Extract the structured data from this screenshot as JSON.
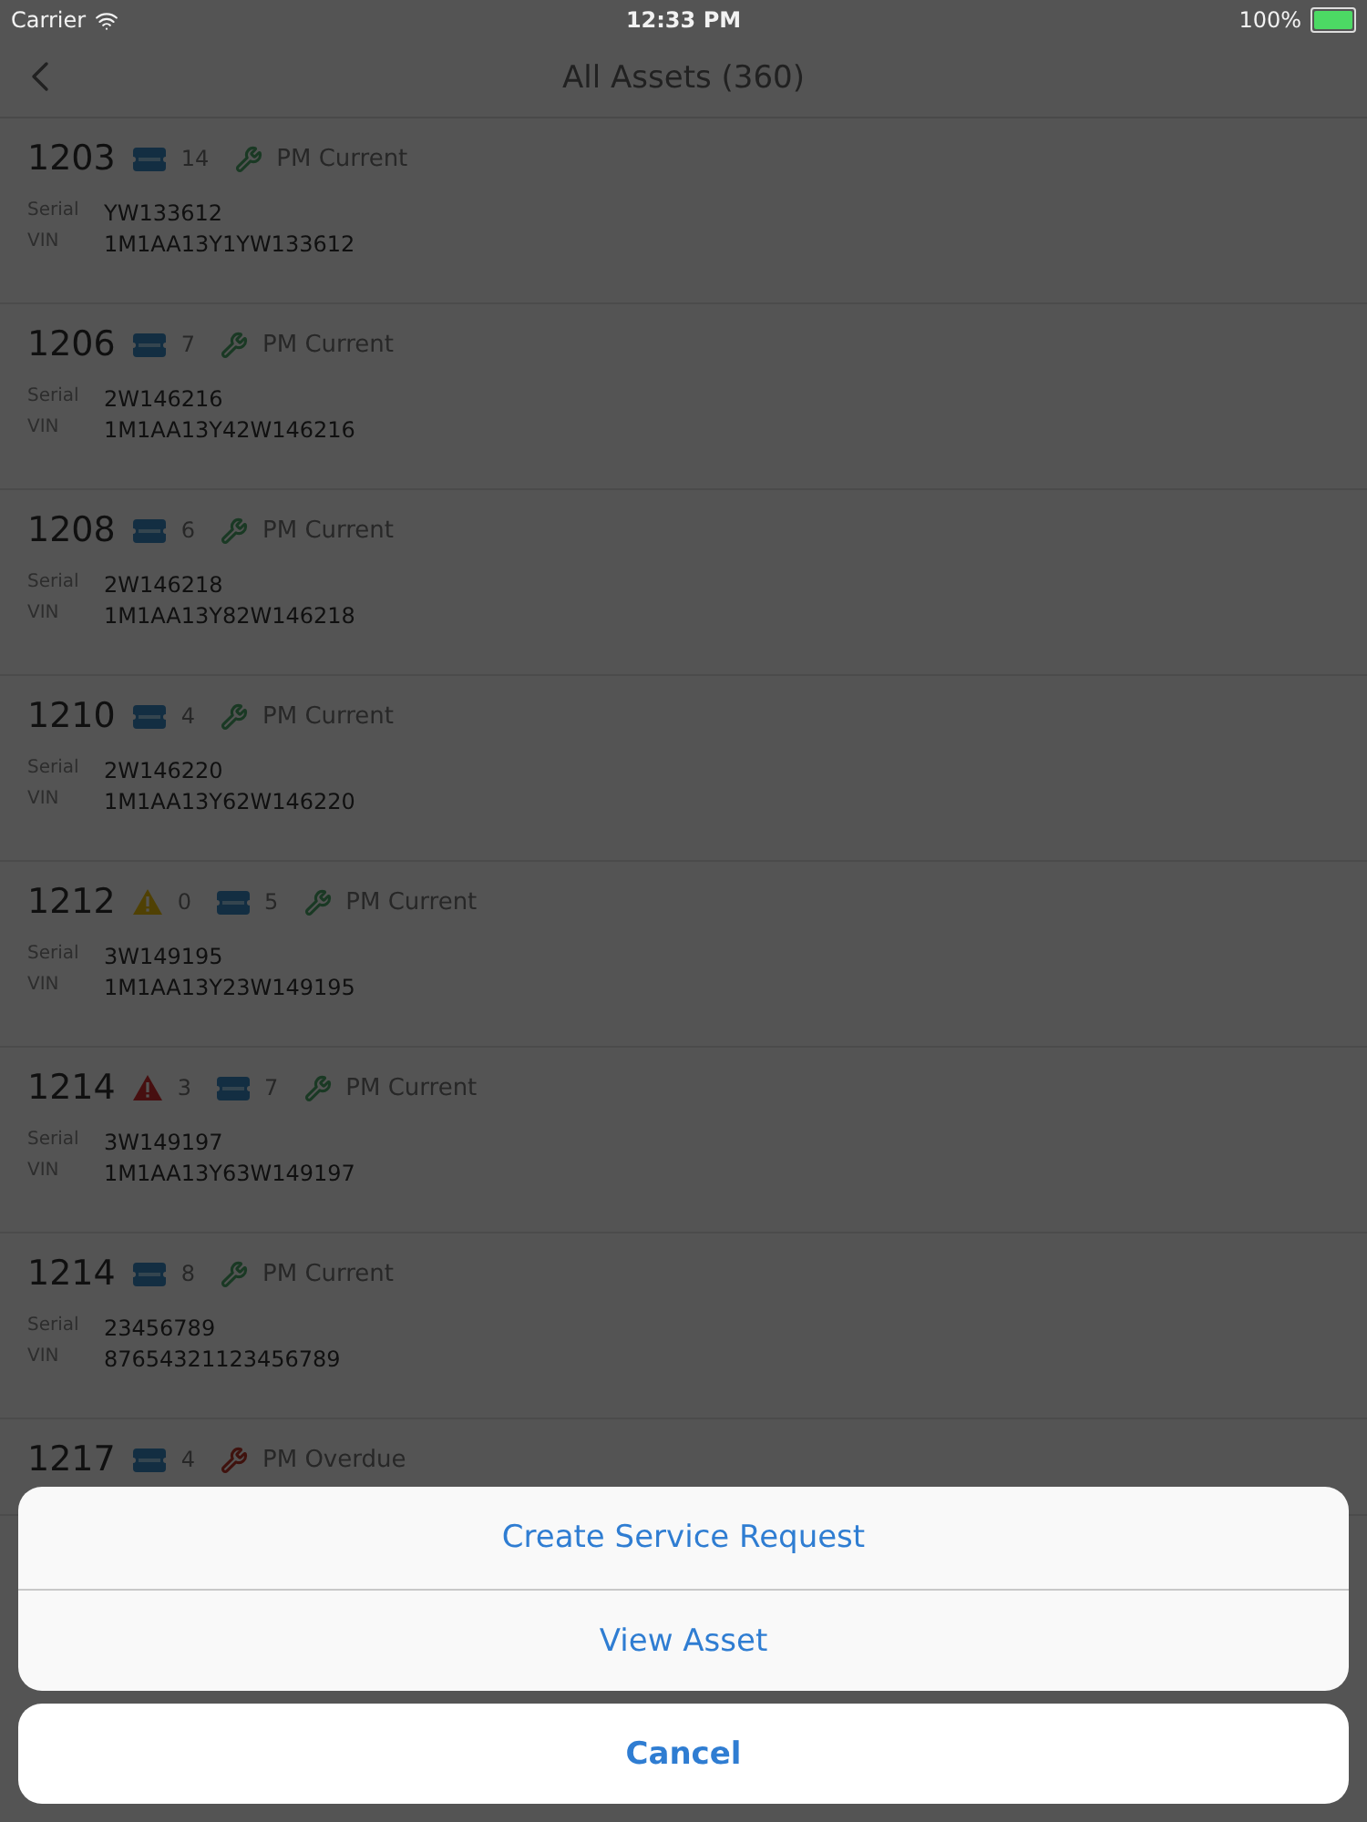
{
  "status_bar": {
    "carrier": "Carrier",
    "time": "12:33 PM",
    "battery": "100%"
  },
  "nav": {
    "title": "All Assets (360)"
  },
  "assets": [
    {
      "number": "1203",
      "tickets": "14",
      "pm": {
        "label": "PM Current",
        "kind": "current"
      },
      "serial_label": "Serial",
      "serial": "YW133612",
      "vin_label": "VIN",
      "vin": "1M1AA13Y1YW133612"
    },
    {
      "number": "1206",
      "tickets": "7",
      "pm": {
        "label": "PM Current",
        "kind": "current"
      },
      "serial_label": "Serial",
      "serial": "2W146216",
      "vin_label": "VIN",
      "vin": "1M1AA13Y42W146216"
    },
    {
      "number": "1208",
      "tickets": "6",
      "pm": {
        "label": "PM Current",
        "kind": "current"
      },
      "serial_label": "Serial",
      "serial": "2W146218",
      "vin_label": "VIN",
      "vin": "1M1AA13Y82W146218"
    },
    {
      "number": "1210",
      "tickets": "4",
      "pm": {
        "label": "PM Current",
        "kind": "current"
      },
      "serial_label": "Serial",
      "serial": "2W146220",
      "vin_label": "VIN",
      "vin": "1M1AA13Y62W146220"
    },
    {
      "number": "1212",
      "alerts": [
        {
          "kind": "warning",
          "count": "0"
        }
      ],
      "tickets": "5",
      "pm": {
        "label": "PM Current",
        "kind": "current"
      },
      "serial_label": "Serial",
      "serial": "3W149195",
      "vin_label": "VIN",
      "vin": "1M1AA13Y23W149195"
    },
    {
      "number": "1214",
      "alerts": [
        {
          "kind": "critical",
          "count": "3"
        }
      ],
      "tickets": "7",
      "pm": {
        "label": "PM Current",
        "kind": "current"
      },
      "serial_label": "Serial",
      "serial": "3W149197",
      "vin_label": "VIN",
      "vin": "1M1AA13Y63W149197"
    },
    {
      "number": "1214",
      "tickets": "8",
      "pm": {
        "label": "PM Current",
        "kind": "current"
      },
      "serial_label": "Serial",
      "serial": "23456789",
      "vin_label": "VIN",
      "vin": "87654321123456789"
    },
    {
      "number": "1217",
      "tickets": "4",
      "pm": {
        "label": "PM Overdue",
        "kind": "overdue"
      }
    }
  ],
  "action_sheet": {
    "actions": [
      "Create Service Request",
      "View Asset"
    ],
    "cancel": "Cancel"
  }
}
